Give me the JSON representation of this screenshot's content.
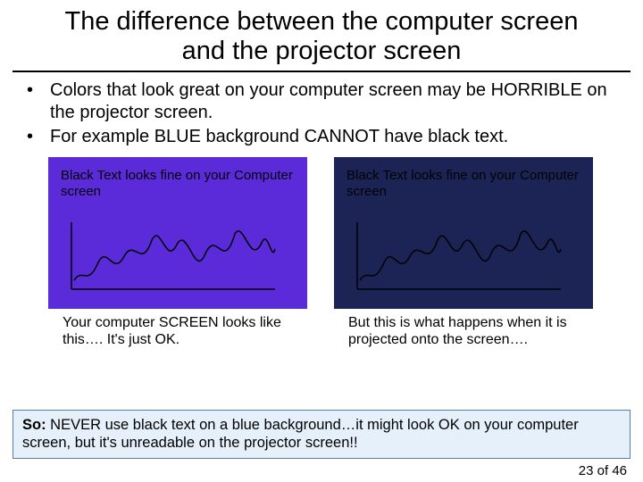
{
  "title": "The difference between the computer screen and the projector screen",
  "bullets": [
    "Colors that look great on your computer screen may be HORRIBLE on the projector screen.",
    "For example BLUE background CANNOT have black text."
  ],
  "panel_left": {
    "box_text": "Black Text looks fine on your Computer screen",
    "caption": "Your computer SCREEN looks like this…. It's just OK."
  },
  "panel_right": {
    "box_text": "Black Text looks fine on your Computer screen",
    "caption": "But this is what happens when it is projected onto the screen…."
  },
  "conclusion_label": "So:",
  "conclusion_text": " NEVER use black text on a blue background…it might look OK on your computer screen, but it's unreadable on the projector screen!!",
  "page_current": "23",
  "page_sep": " of ",
  "page_total": "46"
}
